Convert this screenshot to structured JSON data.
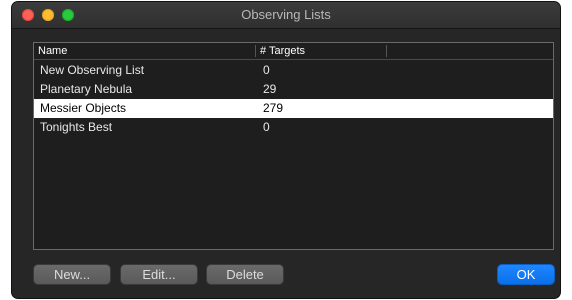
{
  "window": {
    "title": "Observing Lists"
  },
  "table": {
    "columns": [
      "Name",
      "# Targets"
    ],
    "rows": [
      {
        "name": "New Observing List",
        "targets": "0",
        "selected": false
      },
      {
        "name": "Planetary Nebula",
        "targets": "29",
        "selected": false
      },
      {
        "name": "Messier Objects",
        "targets": "279",
        "selected": true
      },
      {
        "name": "Tonights Best",
        "targets": "0",
        "selected": false
      }
    ]
  },
  "buttons": {
    "new_label": "New...",
    "edit_label": "Edit...",
    "delete_label": "Delete",
    "ok_label": "OK"
  },
  "colors": {
    "window_bg": "#262626",
    "selection_bg": "#ffffff",
    "ok_accent": "#0a70ea"
  }
}
